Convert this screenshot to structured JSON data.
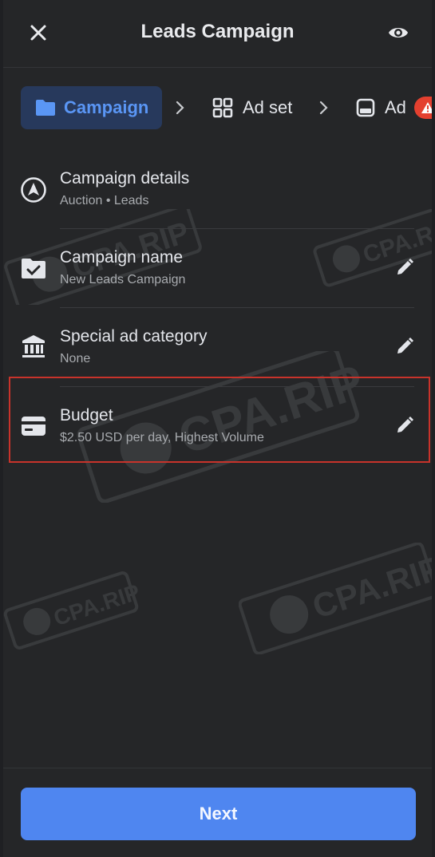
{
  "header": {
    "title": "Leads Campaign",
    "close_icon": "close-icon",
    "preview_icon": "eye-icon"
  },
  "steps": [
    {
      "label": "Campaign",
      "icon": "folder-icon",
      "active": true
    },
    {
      "label": "Ad set",
      "icon": "grid-icon",
      "active": false
    },
    {
      "label": "Ad",
      "icon": "ad-icon",
      "active": false,
      "badge": "warning-icon"
    }
  ],
  "rows": [
    {
      "title": "Campaign details",
      "subtitle": "Auction • Leads",
      "icon": "compass-icon",
      "editable": false
    },
    {
      "title": "Campaign name",
      "subtitle": "New Leads Campaign",
      "icon": "folder-check-icon",
      "editable": true
    },
    {
      "title": "Special ad category",
      "subtitle": "None",
      "icon": "bank-icon",
      "editable": true
    },
    {
      "title": "Budget",
      "subtitle": "$2.50 USD per day, Highest Volume",
      "icon": "card-icon",
      "editable": true
    }
  ],
  "watermark": "CPA.RIP",
  "footer": {
    "next_label": "Next"
  },
  "colors": {
    "background": "#252628",
    "accent": "#4f86f0",
    "active_tab_bg": "#27395c",
    "highlight_border": "#c8332b",
    "warning": "#e4402f"
  }
}
